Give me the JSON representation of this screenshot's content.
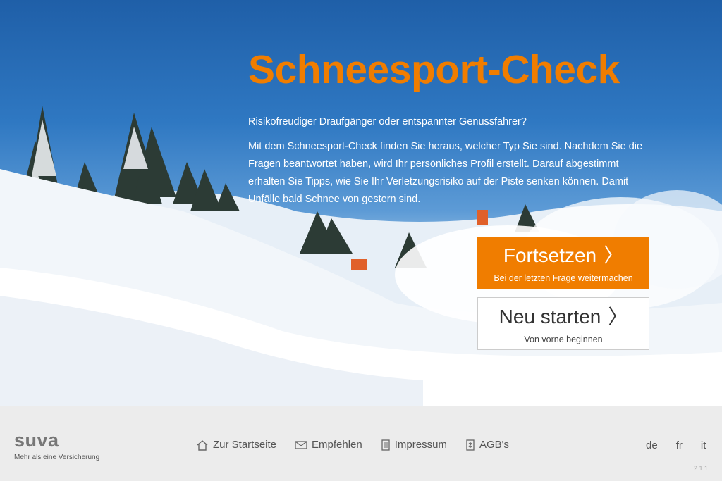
{
  "hero": {
    "title": "Schneesport-Check",
    "lead": "Risikofreudiger Draufgänger oder entspannter Genussfahrer?",
    "body": "Mit dem Schneesport-Check finden Sie heraus, welcher Typ Sie sind. Nachdem Sie die Fragen beantwortet haben, wird Ihr persönliches Profil erstellt. Darauf abgestimmt erhalten Sie Tipps, wie Sie Ihr Verletzungsrisiko auf der Piste senken können. Damit Unfälle bald Schnee von gestern sind."
  },
  "buttons": {
    "continue_label": "Fortsetzen",
    "continue_sub": "Bei der letzten Frage weitermachen",
    "restart_label": "Neu starten",
    "restart_sub": "Von vorne beginnen",
    "chevron": "〉"
  },
  "footer": {
    "logo": "suva",
    "tagline": "Mehr als eine Versicherung",
    "nav": [
      {
        "label": "Zur Startseite",
        "icon": "home-icon"
      },
      {
        "label": "Empfehlen",
        "icon": "envelope-icon"
      },
      {
        "label": "Impressum",
        "icon": "document-icon"
      },
      {
        "label": "AGB's",
        "icon": "contract-icon"
      }
    ],
    "languages": [
      "de",
      "fr",
      "it"
    ],
    "version": "2.1.1"
  },
  "colors": {
    "accent": "#f07d00",
    "footer_bg": "#ececec",
    "sky": "#2f78c2"
  }
}
